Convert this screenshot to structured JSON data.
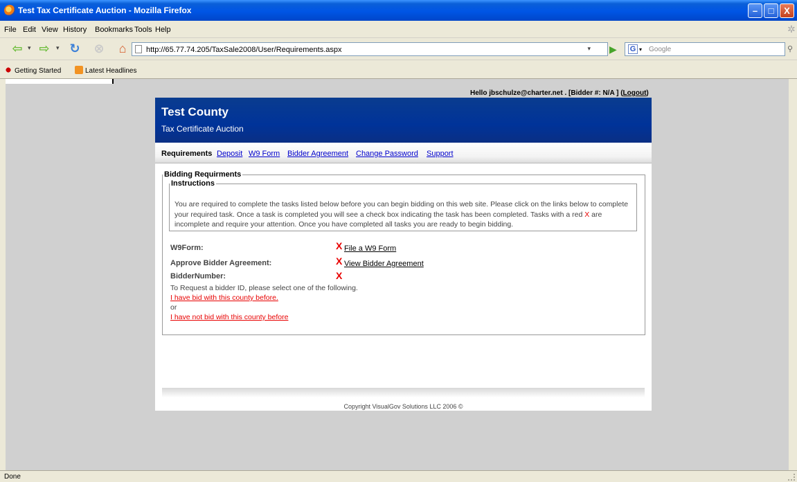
{
  "window": {
    "title": "Test Tax Certificate Auction - Mozilla Firefox",
    "minimize": "–",
    "maximize": "□",
    "close": "X"
  },
  "menu": [
    "File",
    "Edit",
    "View",
    "History",
    "Bookmarks",
    "Tools",
    "Help"
  ],
  "toolbar": {
    "url": "http://65.77.74.205/TaxSale2008/User/Requirements.aspx",
    "search_placeholder": "Google"
  },
  "bookmarks": [
    "Getting Started",
    "Latest Headlines"
  ],
  "header": {
    "greeting": "Hello jbschulze@charter.net . [Bidder #: N/A ] (",
    "logout": "Logout",
    "greeting_end": ")"
  },
  "banner": {
    "county": "Test County",
    "subtitle": "Tax Certificate Auction"
  },
  "nav": {
    "items": [
      "Requirements",
      "Deposit",
      "W9 Form",
      "Bidder Agreement",
      "Change Password",
      "Support"
    ],
    "active": "Requirements"
  },
  "bidding": {
    "legend": "Bidding Requirments",
    "instructions_legend": "Instructions",
    "instructions_part1": "You are required to complete the tasks listed below before you can begin bidding on this web site. Please click on the links below to complete your required task. Once a task is completed you will see a check box indicating the task has been completed. Tasks with a red ",
    "instructions_x": "X",
    "instructions_part2": " are incomplete and require your attention.  Once you have completed all tasks you are ready to begin bidding.",
    "tasks": [
      {
        "label": "W9Form:",
        "status": "X",
        "link": "File a W9 Form"
      },
      {
        "label": "Approve Bidder Agreement:",
        "status": "X",
        "link": "View Bidder Agreement"
      },
      {
        "label": "BidderNumber:",
        "status": "X",
        "link": ""
      }
    ],
    "request_text": "To Request a bidder ID, please select one of the following.",
    "option1": "I have bid with this county before.",
    "or": "or",
    "option2": "I have not bid with this county before"
  },
  "footer": {
    "copyright": "Copyright VisualGov Solutions LLC 2006 ©"
  },
  "status": {
    "text": "Done"
  }
}
